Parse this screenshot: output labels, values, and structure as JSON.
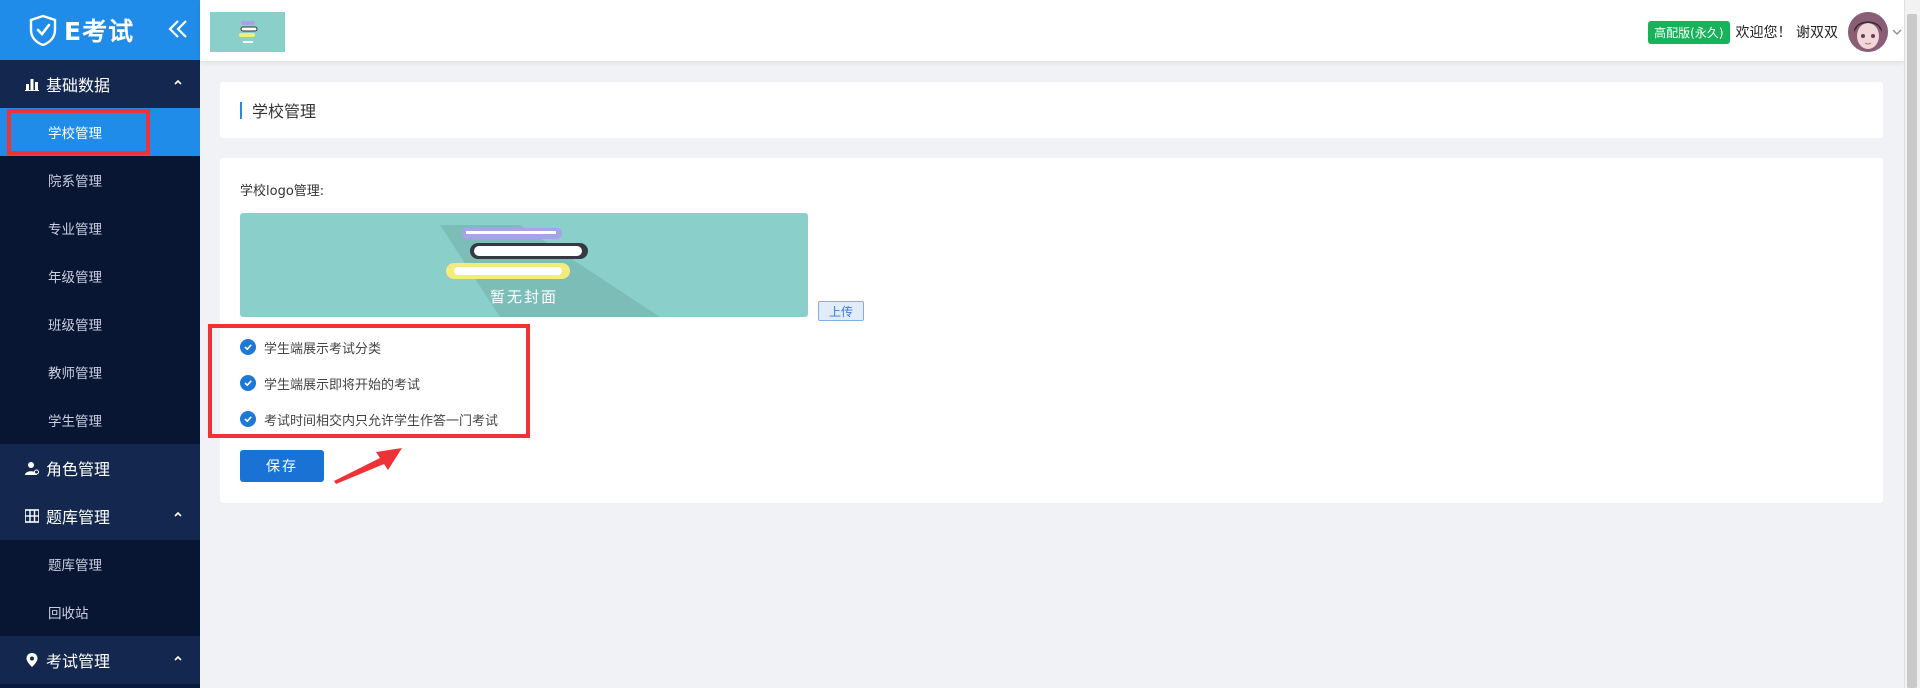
{
  "app": {
    "title": "E考试"
  },
  "sidebar": {
    "groups": [
      {
        "label": "基础数据",
        "icon": "bar-chart-icon",
        "expanded": true,
        "items": [
          {
            "label": "学校管理",
            "active": true
          },
          {
            "label": "院系管理"
          },
          {
            "label": "专业管理"
          },
          {
            "label": "年级管理"
          },
          {
            "label": "班级管理"
          },
          {
            "label": "教师管理"
          },
          {
            "label": "学生管理"
          }
        ]
      },
      {
        "label": "角色管理",
        "icon": "user-icon",
        "expanded": false,
        "items": []
      },
      {
        "label": "题库管理",
        "icon": "grid-icon",
        "expanded": true,
        "items": [
          {
            "label": "题库管理"
          },
          {
            "label": "回收站"
          }
        ]
      },
      {
        "label": "考试管理",
        "icon": "location-pin-icon",
        "expanded": true,
        "items": []
      }
    ]
  },
  "header": {
    "badge": "高配版(永久)",
    "welcome": "欢迎您！ 谢双双"
  },
  "main": {
    "page_title": "学校管理",
    "logo_label": "学校logo管理:",
    "cover_placeholder": "暂无封面",
    "upload_label": "上传",
    "options": [
      {
        "label": "学生端展示考试分类",
        "checked": true
      },
      {
        "label": "学生端展示即将开始的考试",
        "checked": true
      },
      {
        "label": "考试时间相交内只允许学生作答一门考试",
        "checked": true
      }
    ],
    "save_label": "保存"
  },
  "colors": {
    "sidebar_bg": "#0a1b3d",
    "accent": "#1e8ce8",
    "badge": "#17b35a",
    "highlight": "#ee3237",
    "cover_bg": "#8bcfca"
  }
}
